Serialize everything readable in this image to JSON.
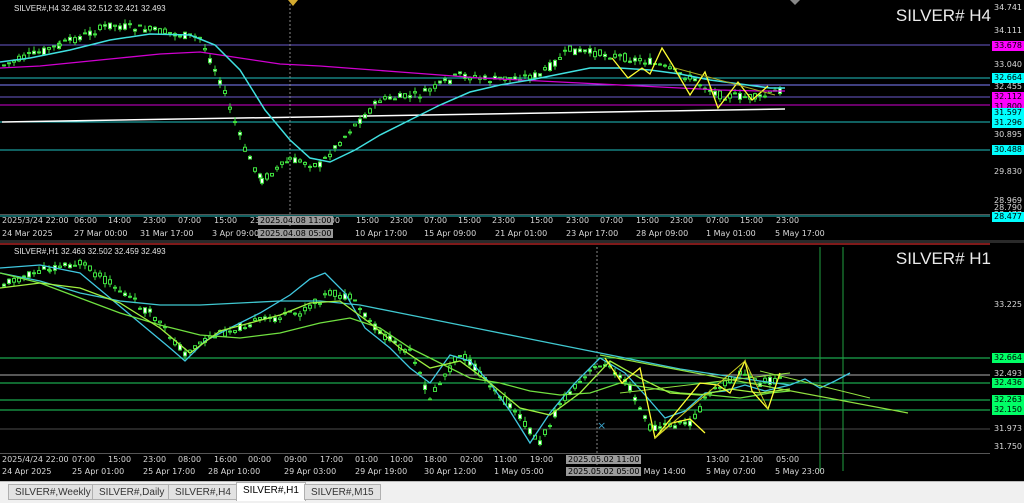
{
  "h4": {
    "header": "SILVER#,H4  32.484 32.512 32.421 32.493",
    "symbol_label": "SILVER# H4",
    "price_ticks": [
      "34.741",
      "34.111",
      "33.678",
      "33.040",
      "32.664",
      "32.455",
      "32.112",
      "31.800",
      "31.597",
      "31.296",
      "30.895",
      "30.488",
      "29.830",
      "28.969",
      "28.790",
      "28.477"
    ],
    "badges": [
      {
        "text": "33.678",
        "color": "#ff00ff"
      },
      {
        "text": "32.664",
        "color": "#00ffff"
      },
      {
        "text": "32.112",
        "color": "#ff00ff"
      },
      {
        "text": "31.800",
        "color": "#ff00ff"
      },
      {
        "text": "31.597",
        "color": "#00ffff"
      },
      {
        "text": "31.296",
        "color": "#00ffff"
      },
      {
        "text": "30.488",
        "color": "#00ffff"
      },
      {
        "text": "28.477",
        "color": "#00ffff"
      }
    ],
    "time_labels": [
      "2025/3/24 22:00",
      "06:00",
      "14:00",
      "23:00",
      "07:00",
      "15:00",
      "23:00",
      "7:00",
      "15:00",
      "23:00",
      "07:00",
      "15:00",
      "23:00",
      "15:00",
      "23:00",
      "07:00",
      "15:00",
      "23:00",
      "07:00",
      "15:00",
      "23:00"
    ],
    "date_labels": [
      "24 Mar 2025",
      "27 Mar 00:00",
      "31 Mar 17:00",
      "3 Apr 09:00",
      "7 Apr 02:00",
      "10 Apr 17:00",
      "15 Apr 09:00",
      "21 Apr 01:00",
      "23 Apr 17:00",
      "28 Apr 09:00",
      "1 May 01:00",
      "5 May 17:00"
    ],
    "crosshair_time": "2025.04.08 11:00",
    "crosshair_time2": "2025.04.08 05:00"
  },
  "h1": {
    "header": "SILVER#,H1  32.463 32.502 32.459 32.493",
    "symbol_label": "SILVER# H1",
    "price_ticks": [
      "33.225",
      "32.664",
      "32.493",
      "32.436",
      "32.263",
      "32.150",
      "31.973",
      "31.750"
    ],
    "badges": [
      {
        "text": "32.664",
        "color": "#00ff66"
      },
      {
        "text": "32.436",
        "color": "#00ff66"
      },
      {
        "text": "32.263",
        "color": "#00ff66"
      },
      {
        "text": "32.150",
        "color": "#00ff66"
      }
    ],
    "time_labels": [
      "2025/4/24 22:00",
      "07:00",
      "15:00",
      "23:00",
      "08:00",
      "16:00",
      "00:00",
      "09:00",
      "17:00",
      "01:00",
      "10:00",
      "18:00",
      "02:00",
      "11:00",
      "19:00",
      "04:00",
      "13:00",
      "21:00",
      "05:00"
    ],
    "date_labels": [
      "24 Apr 2025",
      "25 Apr 01:00",
      "25 Apr 17:00",
      "28 Apr 10:00",
      "29 Apr 03:00",
      "29 Apr 19:00",
      "30 Apr 12:00",
      "1 May 05:00",
      "2 May 14:00",
      "5 May 07:00",
      "5 May 23:00"
    ],
    "crosshair_time": "2025.05.02 11:00",
    "crosshair_time2": "2025.05.02 05:00"
  },
  "tabs": [
    "SILVER#,Weekly",
    "SILVER#,Daily",
    "SILVER#,H4",
    "SILVER#,H1",
    "SILVER#,M15"
  ],
  "active_tab": "SILVER#,H1"
}
